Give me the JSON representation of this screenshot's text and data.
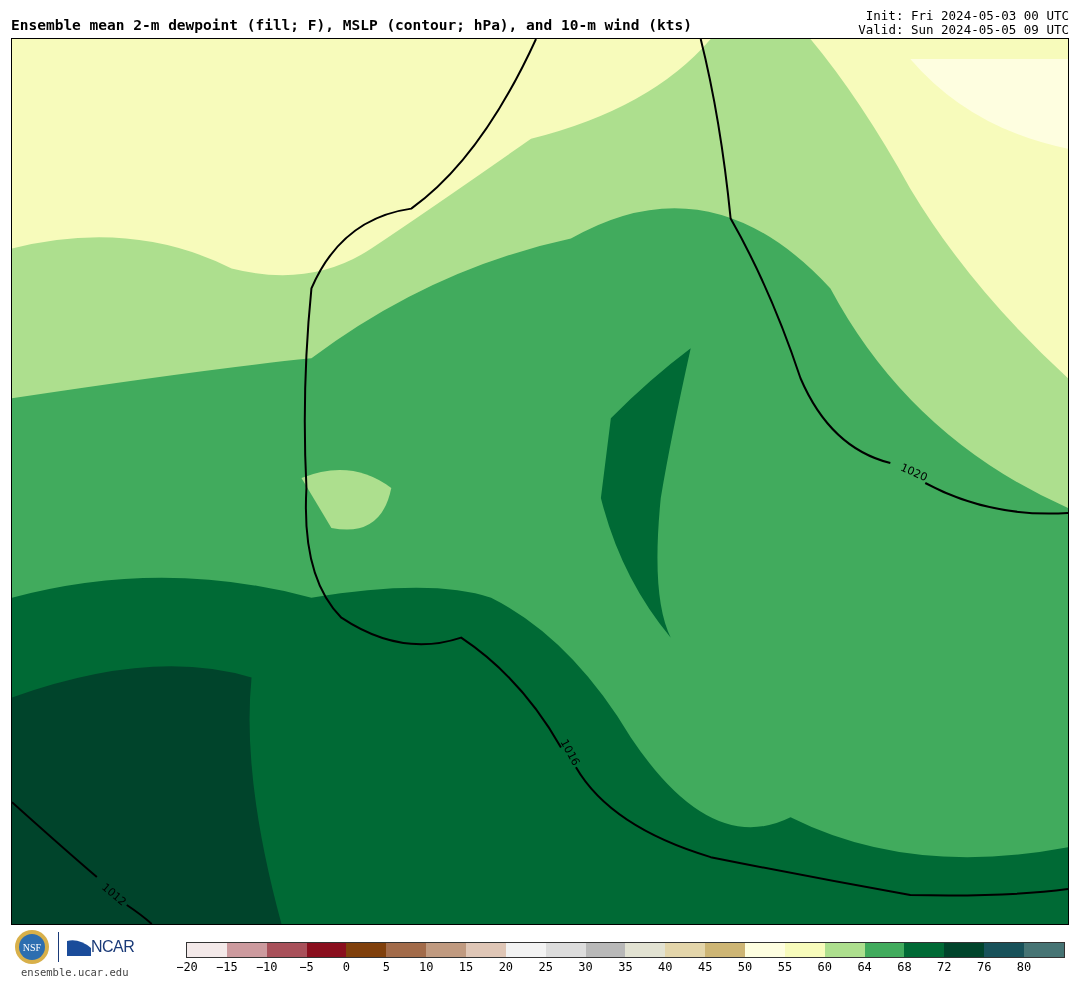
{
  "title": "Ensemble mean 2-m dewpoint (fill; F), MSLP (contour; hPa), and 10-m wind (kts)",
  "init": "Init: Fri 2024-05-03 00 UTC",
  "valid": "Valid: Sun 2024-05-05 09 UTC",
  "map": {
    "contour_labels": [
      "1020",
      "1016",
      "1012"
    ]
  },
  "logos": {
    "nsf": "NSF",
    "ncar": "NCAR",
    "url": "ensemble.ucar.edu"
  },
  "colorbar": [
    {
      "color": "#f3e9e9",
      "label": "−20"
    },
    {
      "color": "#cc9a9e",
      "label": "−15"
    },
    {
      "color": "#a8505a",
      "label": "−10"
    },
    {
      "color": "#8a0f1e",
      "label": "−5"
    },
    {
      "color": "#80400c",
      "label": "0"
    },
    {
      "color": "#a26b4a",
      "label": "5"
    },
    {
      "color": "#c09a80",
      "label": "10"
    },
    {
      "color": "#dfc6b6",
      "label": "15"
    },
    {
      "color": "#f2f2f2",
      "label": "20"
    },
    {
      "color": "#dcdcdc",
      "label": "25"
    },
    {
      "color": "#b8b8b8",
      "label": "30"
    },
    {
      "color": "#e2e2d2",
      "label": "35"
    },
    {
      "color": "#e3d5aa",
      "label": "40"
    },
    {
      "color": "#cdb574",
      "label": "45"
    },
    {
      "color": "#fefee0",
      "label": "50"
    },
    {
      "color": "#f7fbbb",
      "label": "55"
    },
    {
      "color": "#addf8e",
      "label": "60"
    },
    {
      "color": "#41ab5d",
      "label": "64"
    },
    {
      "color": "#006a35",
      "label": "68"
    },
    {
      "color": "#00442b",
      "label": "72"
    },
    {
      "color": "#18525a",
      "label": "76"
    },
    {
      "color": "#467474",
      "label": "80"
    }
  ]
}
